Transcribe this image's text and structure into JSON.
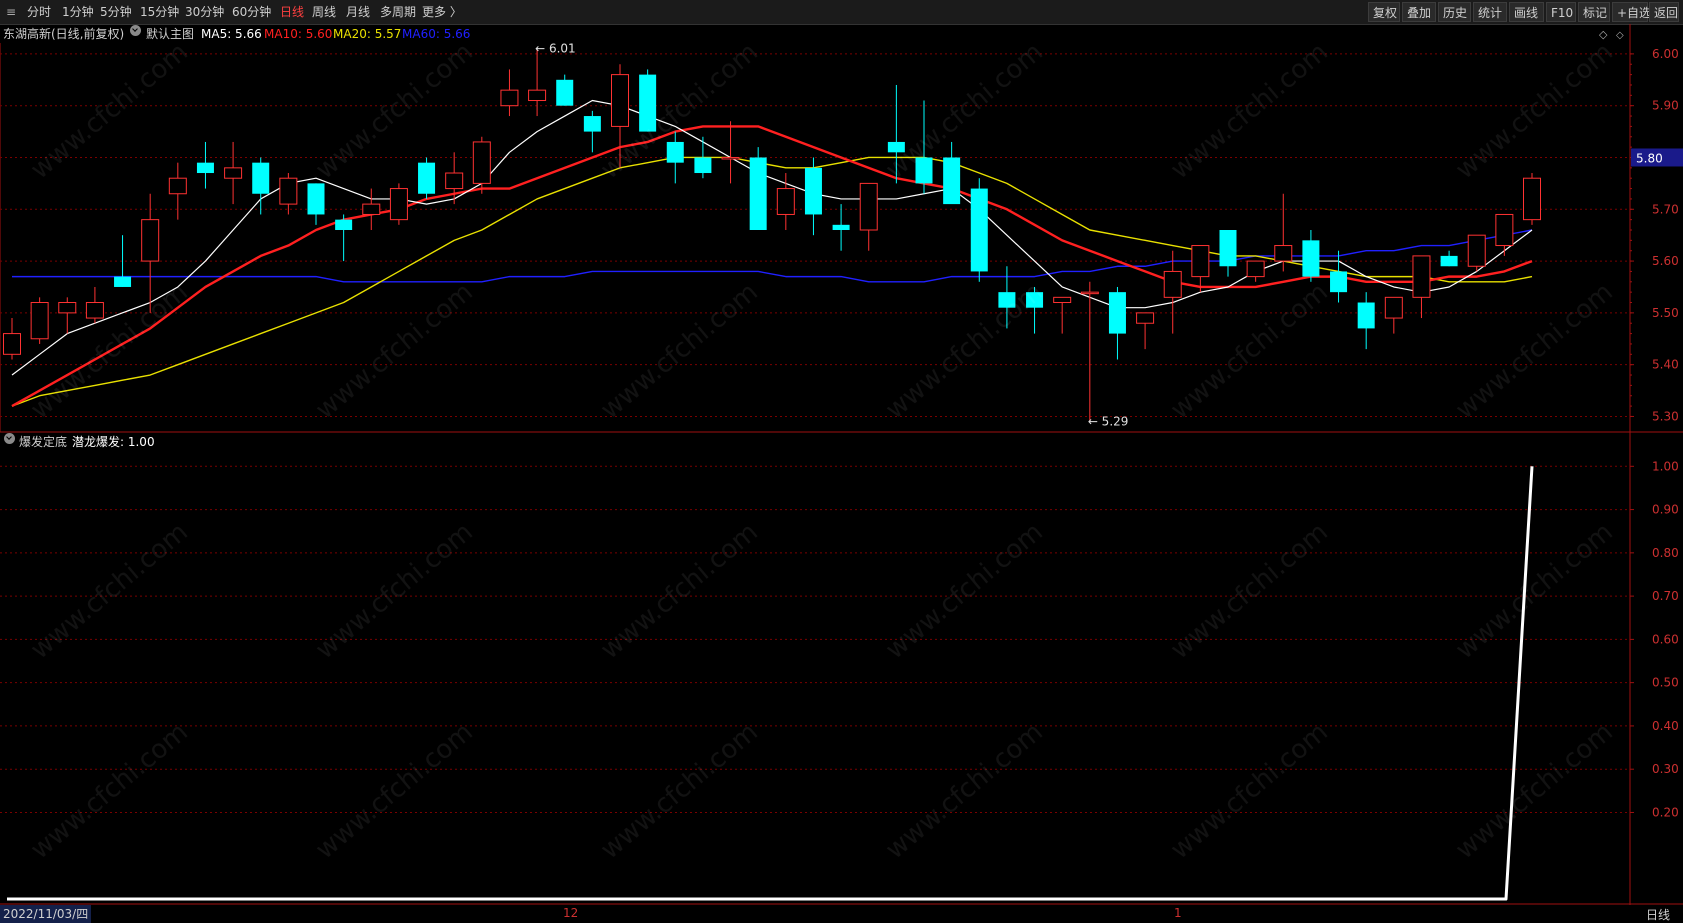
{
  "toolbar": {
    "left_items": [
      "分时",
      "1分钟",
      "5分钟",
      "15分钟",
      "30分钟",
      "60分钟",
      "日线",
      "周线",
      "月线",
      "多周期",
      "更多 〉"
    ],
    "active_item": "日线",
    "right_items": [
      "复权",
      "叠加",
      "历史",
      "统计",
      "画线",
      "F10",
      "标记",
      "+自选",
      "返回"
    ]
  },
  "main_chart": {
    "stock_title": "东湖高新(日线,前复权)",
    "template_label": "默认主图",
    "ma_labels": [
      {
        "text": "MA5: 5.66",
        "color": "#ffffff"
      },
      {
        "text": "MA10: 5.60",
        "color": "#ff2020"
      },
      {
        "text": "MA20: 5.57",
        "color": "#e8e000"
      },
      {
        "text": "MA60: 5.66",
        "color": "#2020ff"
      }
    ],
    "price_ticks": [
      "6.00",
      "5.90",
      "5.80",
      "5.70",
      "5.60",
      "5.50",
      "5.40",
      "5.30"
    ],
    "current_price": "5.80",
    "high_annotation": "6.01",
    "low_annotation": "5.29"
  },
  "indicator": {
    "title": "爆发定底",
    "value_label": "潜龙爆发: 1.00",
    "ticks": [
      "1.00",
      "0.90",
      "0.80",
      "0.70",
      "0.60",
      "0.50",
      "0.40",
      "0.30",
      "0.20"
    ]
  },
  "footer": {
    "date_label": "2022/11/03/四",
    "month_labels": [
      "12",
      "1"
    ],
    "period_label": "日线"
  },
  "watermark": "www.cfchi.com",
  "colors": {
    "up": "#ff3232",
    "down": "#00ffff",
    "ma5": "#ffffff",
    "ma10": "#ff2020",
    "ma20": "#e8e000",
    "ma60": "#2020ff",
    "grid": "#7a0000"
  },
  "chart_data": {
    "type": "candlestick",
    "ohlc": [
      [
        5.42,
        5.49,
        5.41,
        5.46
      ],
      [
        5.45,
        5.53,
        5.44,
        5.52
      ],
      [
        5.5,
        5.53,
        5.46,
        5.52
      ],
      [
        5.49,
        5.55,
        5.48,
        5.52
      ],
      [
        5.57,
        5.65,
        5.55,
        5.55
      ],
      [
        5.6,
        5.73,
        5.5,
        5.68
      ],
      [
        5.73,
        5.79,
        5.68,
        5.76
      ],
      [
        5.79,
        5.83,
        5.74,
        5.77
      ],
      [
        5.76,
        5.83,
        5.71,
        5.78
      ],
      [
        5.79,
        5.8,
        5.69,
        5.73
      ],
      [
        5.71,
        5.77,
        5.69,
        5.76
      ],
      [
        5.75,
        5.75,
        5.67,
        5.69
      ],
      [
        5.68,
        5.69,
        5.6,
        5.66
      ],
      [
        5.69,
        5.74,
        5.66,
        5.71
      ],
      [
        5.68,
        5.75,
        5.67,
        5.74
      ],
      [
        5.79,
        5.8,
        5.72,
        5.73
      ],
      [
        5.74,
        5.81,
        5.71,
        5.77
      ],
      [
        5.75,
        5.84,
        5.73,
        5.83
      ],
      [
        5.9,
        5.97,
        5.88,
        5.93
      ],
      [
        5.91,
        6.01,
        5.88,
        5.93
      ],
      [
        5.95,
        5.96,
        5.9,
        5.9
      ],
      [
        5.88,
        5.89,
        5.81,
        5.85
      ],
      [
        5.86,
        5.98,
        5.78,
        5.96
      ],
      [
        5.96,
        5.97,
        5.85,
        5.85
      ],
      [
        5.83,
        5.85,
        5.75,
        5.79
      ],
      [
        5.8,
        5.84,
        5.76,
        5.77
      ],
      [
        5.8,
        5.87,
        5.75,
        5.8
      ],
      [
        5.8,
        5.82,
        5.66,
        5.66
      ],
      [
        5.69,
        5.77,
        5.66,
        5.74
      ],
      [
        5.78,
        5.8,
        5.65,
        5.69
      ],
      [
        5.67,
        5.71,
        5.62,
        5.66
      ],
      [
        5.66,
        5.75,
        5.62,
        5.75
      ],
      [
        5.83,
        5.94,
        5.75,
        5.81
      ],
      [
        5.8,
        5.91,
        5.73,
        5.75
      ],
      [
        5.8,
        5.83,
        5.73,
        5.71
      ],
      [
        5.74,
        5.76,
        5.56,
        5.58
      ],
      [
        5.54,
        5.59,
        5.47,
        5.51
      ],
      [
        5.54,
        5.55,
        5.46,
        5.51
      ],
      [
        5.52,
        5.53,
        5.46,
        5.53
      ],
      [
        5.54,
        5.56,
        5.29,
        5.54
      ],
      [
        5.54,
        5.55,
        5.41,
        5.46
      ],
      [
        5.48,
        5.5,
        5.43,
        5.5
      ],
      [
        5.53,
        5.62,
        5.46,
        5.58
      ],
      [
        5.57,
        5.63,
        5.54,
        5.63
      ],
      [
        5.66,
        5.66,
        5.57,
        5.59
      ],
      [
        5.57,
        5.6,
        5.56,
        5.6
      ],
      [
        5.6,
        5.73,
        5.58,
        5.63
      ],
      [
        5.64,
        5.66,
        5.56,
        5.57
      ],
      [
        5.58,
        5.62,
        5.52,
        5.54
      ],
      [
        5.52,
        5.54,
        5.43,
        5.47
      ],
      [
        5.49,
        5.53,
        5.46,
        5.53
      ],
      [
        5.53,
        5.61,
        5.49,
        5.61
      ],
      [
        5.61,
        5.62,
        5.59,
        5.59
      ],
      [
        5.59,
        5.65,
        5.58,
        5.65
      ],
      [
        5.63,
        5.66,
        5.61,
        5.69
      ],
      [
        5.68,
        5.77,
        5.67,
        5.76
      ]
    ],
    "ma5": [
      5.38,
      5.42,
      5.46,
      5.48,
      5.5,
      5.52,
      5.55,
      5.6,
      5.66,
      5.72,
      5.75,
      5.76,
      5.74,
      5.72,
      5.72,
      5.71,
      5.72,
      5.75,
      5.81,
      5.85,
      5.88,
      5.91,
      5.9,
      5.88,
      5.86,
      5.83,
      5.8,
      5.77,
      5.75,
      5.73,
      5.72,
      5.72,
      5.72,
      5.73,
      5.74,
      5.7,
      5.65,
      5.6,
      5.55,
      5.53,
      5.51,
      5.51,
      5.52,
      5.54,
      5.55,
      5.58,
      5.6,
      5.6,
      5.6,
      5.57,
      5.55,
      5.54,
      5.55,
      5.58,
      5.62,
      5.66
    ],
    "ma10": [
      5.32,
      5.35,
      5.38,
      5.41,
      5.44,
      5.47,
      5.51,
      5.55,
      5.58,
      5.61,
      5.63,
      5.66,
      5.68,
      5.69,
      5.7,
      5.72,
      5.73,
      5.74,
      5.74,
      5.76,
      5.78,
      5.8,
      5.82,
      5.83,
      5.85,
      5.86,
      5.86,
      5.86,
      5.84,
      5.82,
      5.8,
      5.78,
      5.76,
      5.75,
      5.74,
      5.72,
      5.7,
      5.67,
      5.64,
      5.62,
      5.6,
      5.58,
      5.56,
      5.55,
      5.55,
      5.55,
      5.56,
      5.57,
      5.57,
      5.56,
      5.56,
      5.56,
      5.57,
      5.57,
      5.58,
      5.6
    ],
    "ma20": [
      5.32,
      5.34,
      5.35,
      5.36,
      5.37,
      5.38,
      5.4,
      5.42,
      5.44,
      5.46,
      5.48,
      5.5,
      5.52,
      5.55,
      5.58,
      5.61,
      5.64,
      5.66,
      5.69,
      5.72,
      5.74,
      5.76,
      5.78,
      5.79,
      5.8,
      5.8,
      5.8,
      5.79,
      5.78,
      5.78,
      5.79,
      5.8,
      5.8,
      5.8,
      5.79,
      5.77,
      5.75,
      5.72,
      5.69,
      5.66,
      5.65,
      5.64,
      5.63,
      5.62,
      5.61,
      5.61,
      5.6,
      5.59,
      5.58,
      5.57,
      5.57,
      5.57,
      5.56,
      5.56,
      5.56,
      5.57
    ],
    "ma60": [
      5.57,
      5.57,
      5.57,
      5.57,
      5.57,
      5.57,
      5.57,
      5.57,
      5.57,
      5.57,
      5.57,
      5.57,
      5.56,
      5.56,
      5.56,
      5.56,
      5.56,
      5.56,
      5.57,
      5.57,
      5.57,
      5.58,
      5.58,
      5.58,
      5.58,
      5.58,
      5.58,
      5.58,
      5.57,
      5.57,
      5.57,
      5.56,
      5.56,
      5.56,
      5.57,
      5.57,
      5.57,
      5.57,
      5.58,
      5.58,
      5.59,
      5.59,
      5.6,
      5.6,
      5.6,
      5.61,
      5.61,
      5.61,
      5.61,
      5.62,
      5.62,
      5.63,
      5.63,
      5.64,
      5.65,
      5.66
    ],
    "indicator_series": [
      0,
      0,
      0,
      0,
      0,
      0,
      0,
      0,
      0,
      0,
      0,
      0,
      0,
      0,
      0,
      0,
      0,
      0,
      0,
      0,
      0,
      0,
      0,
      0,
      0,
      0,
      0,
      0,
      0,
      0,
      0,
      0,
      0,
      0,
      0,
      0,
      0,
      0,
      0,
      0,
      0,
      0,
      0,
      0,
      0,
      0,
      0,
      0,
      0,
      0,
      0,
      0,
      0,
      0,
      0,
      1
    ],
    "price_ylim": [
      5.27,
      6.05
    ],
    "indicator_ylim": [
      0,
      1.04
    ]
  }
}
